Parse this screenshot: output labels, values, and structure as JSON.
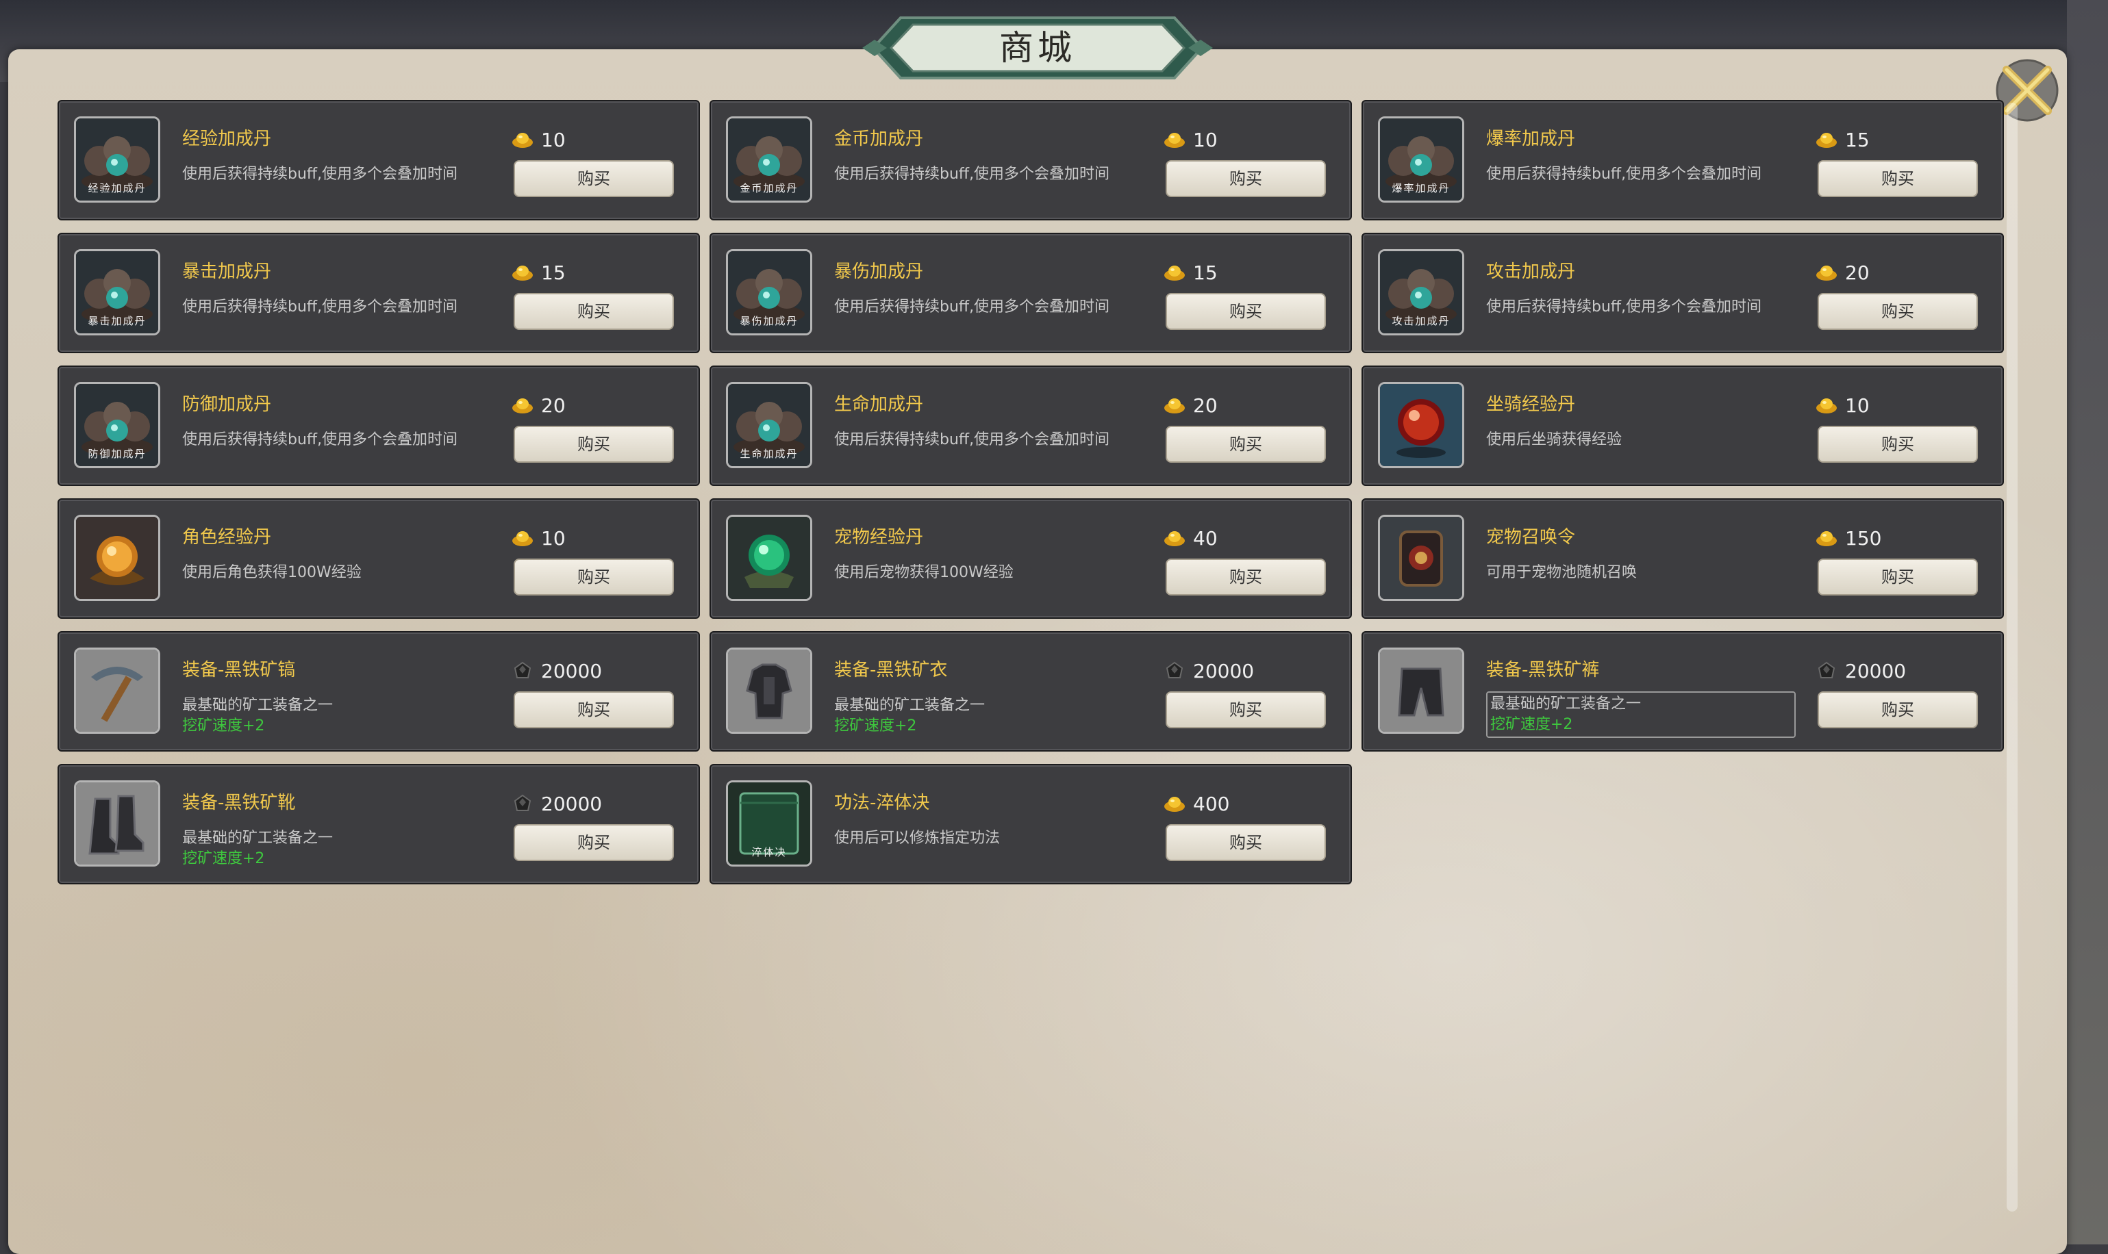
{
  "header": {
    "title": "商城"
  },
  "colors": {
    "name": "#f2c94c",
    "bonus": "#3ec73e",
    "card": "#3d3d40",
    "panel": "#d6cdbd"
  },
  "items": [
    {
      "name": "经验加成丹",
      "desc": "使用后获得持续buff,使用多个会叠加时间",
      "price": "10",
      "currency": "gold-ingot-icon",
      "thumb_label": "经验加成丹",
      "buy": "购买",
      "icon": "pill-tray-icon"
    },
    {
      "name": "金币加成丹",
      "desc": "使用后获得持续buff,使用多个会叠加时间",
      "price": "10",
      "currency": "gold-ingot-icon",
      "thumb_label": "金币加成丹",
      "buy": "购买",
      "icon": "pill-tray-icon"
    },
    {
      "name": "爆率加成丹",
      "desc": "使用后获得持续buff,使用多个会叠加时间",
      "price": "15",
      "currency": "gold-ingot-icon",
      "thumb_label": "爆率加成丹",
      "buy": "购买",
      "icon": "pill-tray-icon"
    },
    {
      "name": "暴击加成丹",
      "desc": "使用后获得持续buff,使用多个会叠加时间",
      "price": "15",
      "currency": "gold-ingot-icon",
      "thumb_label": "暴击加成丹",
      "buy": "购买",
      "icon": "pill-tray-icon"
    },
    {
      "name": "暴伤加成丹",
      "desc": "使用后获得持续buff,使用多个会叠加时间",
      "price": "15",
      "currency": "gold-ingot-icon",
      "thumb_label": "暴伤加成丹",
      "buy": "购买",
      "icon": "pill-tray-icon"
    },
    {
      "name": "攻击加成丹",
      "desc": "使用后获得持续buff,使用多个会叠加时间",
      "price": "20",
      "currency": "gold-ingot-icon",
      "thumb_label": "攻击加成丹",
      "buy": "购买",
      "icon": "pill-tray-icon"
    },
    {
      "name": "防御加成丹",
      "desc": "使用后获得持续buff,使用多个会叠加时间",
      "price": "20",
      "currency": "gold-ingot-icon",
      "thumb_label": "防御加成丹",
      "buy": "购买",
      "icon": "pill-tray-icon"
    },
    {
      "name": "生命加成丹",
      "desc": "使用后获得持续buff,使用多个会叠加时间",
      "price": "20",
      "currency": "gold-ingot-icon",
      "thumb_label": "生命加成丹",
      "buy": "购买",
      "icon": "pill-tray-icon"
    },
    {
      "name": "坐骑经验丹",
      "desc": "使用后坐骑获得经验",
      "price": "10",
      "currency": "gold-ingot-icon",
      "thumb_label": "",
      "buy": "购买",
      "icon": "red-orb-icon"
    },
    {
      "name": "角色经验丹",
      "desc": "使用后角色获得100W经验",
      "price": "10",
      "currency": "gold-ingot-icon",
      "thumb_label": "",
      "buy": "购买",
      "icon": "amber-orb-icon"
    },
    {
      "name": "宠物经验丹",
      "desc": "使用后宠物获得100W经验",
      "price": "40",
      "currency": "gold-ingot-icon",
      "thumb_label": "",
      "buy": "购买",
      "icon": "jade-orb-icon"
    },
    {
      "name": "宠物召唤令",
      "desc": "可用于宠物池随机召唤",
      "price": "150",
      "currency": "gold-ingot-icon",
      "thumb_label": "",
      "buy": "购买",
      "icon": "summon-token-icon"
    },
    {
      "name": "装备-黑铁矿镐",
      "desc": "最基础的矿工装备之一",
      "bonus": "挖矿速度+2",
      "price": "20000",
      "currency": "black-ore-icon",
      "thumb_label": "",
      "buy": "购买",
      "icon": "pickaxe-icon"
    },
    {
      "name": "装备-黑铁矿衣",
      "desc": "最基础的矿工装备之一",
      "bonus": "挖矿速度+2",
      "price": "20000",
      "currency": "black-ore-icon",
      "thumb_label": "",
      "buy": "购买",
      "icon": "armor-icon"
    },
    {
      "name": "装备-黑铁矿裤",
      "desc": "最基础的矿工装备之一",
      "bonus": "挖矿速度+2",
      "price": "20000",
      "currency": "black-ore-icon",
      "thumb_label": "",
      "buy": "购买",
      "icon": "pants-icon",
      "boxed": true
    },
    {
      "name": "装备-黑铁矿靴",
      "desc": "最基础的矿工装备之一",
      "bonus": "挖矿速度+2",
      "price": "20000",
      "currency": "black-ore-icon",
      "thumb_label": "",
      "buy": "购买",
      "icon": "boots-icon"
    },
    {
      "name": "功法-淬体决",
      "desc": "使用后可以修炼指定功法",
      "price": "400",
      "currency": "gold-ingot-icon",
      "thumb_label": "淬体决",
      "buy": "购买",
      "icon": "scroll-book-icon"
    }
  ]
}
